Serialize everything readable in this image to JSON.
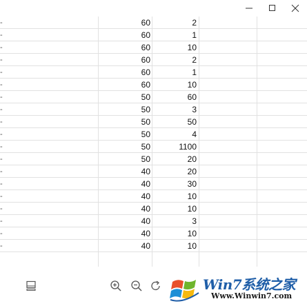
{
  "window": {
    "minimize_glyph": "–",
    "maximize_glyph": "☐",
    "close_glyph": "✕"
  },
  "sheet": {
    "rows": [
      {
        "a": "-",
        "b": "60",
        "c": "2"
      },
      {
        "a": "-",
        "b": "60",
        "c": "1"
      },
      {
        "a": "-",
        "b": "60",
        "c": "10"
      },
      {
        "a": "-",
        "b": "60",
        "c": "2"
      },
      {
        "a": "-",
        "b": "60",
        "c": "1"
      },
      {
        "a": "-",
        "b": "60",
        "c": "10"
      },
      {
        "a": "-",
        "b": "50",
        "c": "60"
      },
      {
        "a": "-",
        "b": "50",
        "c": "3"
      },
      {
        "a": "-",
        "b": "50",
        "c": "50"
      },
      {
        "a": "-",
        "b": "50",
        "c": "4"
      },
      {
        "a": "-",
        "b": "50",
        "c": "1100"
      },
      {
        "a": "-",
        "b": "50",
        "c": "20"
      },
      {
        "a": "-",
        "b": "40",
        "c": "20"
      },
      {
        "a": "-",
        "b": "40",
        "c": "30"
      },
      {
        "a": "-",
        "b": "40",
        "c": "10"
      },
      {
        "a": "-",
        "b": "40",
        "c": "10"
      },
      {
        "a": "-",
        "b": "40",
        "c": "3"
      },
      {
        "a": "-",
        "b": "40",
        "c": "10"
      },
      {
        "a": "-",
        "b": "40",
        "c": "10"
      }
    ]
  },
  "toolbar": {
    "icons": [
      "monitor-icon",
      "zoom-in-icon",
      "zoom-out-icon",
      "rotate-icon"
    ]
  },
  "watermark": {
    "title": "Win7系统之家",
    "url": "Www.Winwin7.com"
  },
  "colors": {
    "gridline": "#e1e1e1",
    "watermark_blue": "#1f5ea8"
  }
}
